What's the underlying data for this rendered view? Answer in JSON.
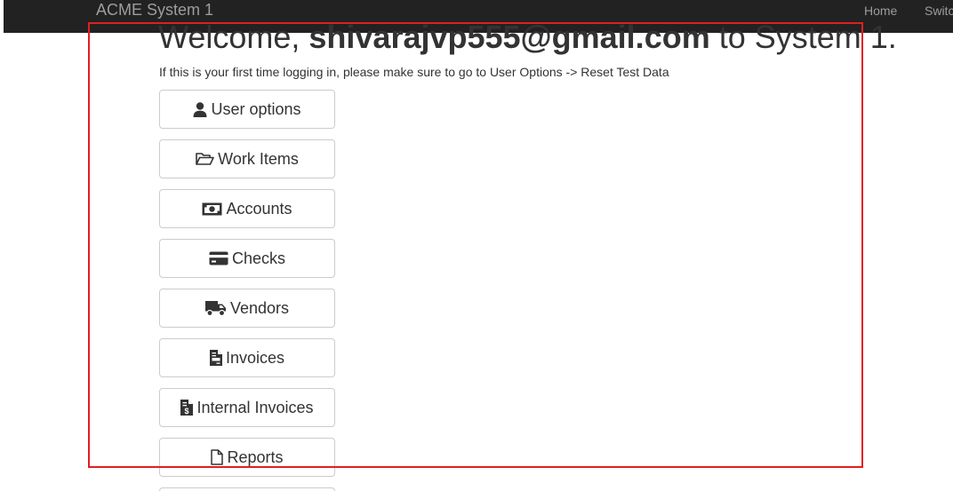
{
  "navbar": {
    "brand": "ACME System 1",
    "home": "Home",
    "switch": "Switc"
  },
  "main": {
    "welcome_prefix": "Welcome, ",
    "welcome_user": "shivarajvp555@gmail.com",
    "welcome_suffix": " to System 1.",
    "intro": "If this is your first time logging in, please make sure to go to User Options -> Reset Test Data"
  },
  "menu": [
    {
      "label": "User options",
      "icon": "user-icon"
    },
    {
      "label": "Work Items",
      "icon": "folder-open-icon"
    },
    {
      "label": "Accounts",
      "icon": "money-bill-icon"
    },
    {
      "label": "Checks",
      "icon": "credit-card-icon"
    },
    {
      "label": "Vendors",
      "icon": "truck-icon"
    },
    {
      "label": "Invoices",
      "icon": "file-invoice-icon"
    },
    {
      "label": "Internal Invoices",
      "icon": "file-invoice-dollar-icon"
    },
    {
      "label": "Reports",
      "icon": "file-icon"
    }
  ],
  "colors": {
    "navbar_bg": "#222222",
    "navbar_text": "#9d9d9d",
    "highlight": "#e0201e"
  }
}
